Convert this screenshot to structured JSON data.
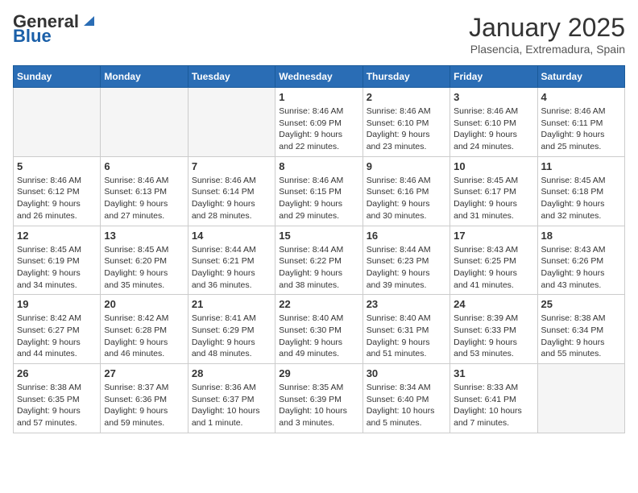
{
  "header": {
    "logo_general": "General",
    "logo_blue": "Blue",
    "month_title": "January 2025",
    "location": "Plasencia, Extremadura, Spain"
  },
  "weekdays": [
    "Sunday",
    "Monday",
    "Tuesday",
    "Wednesday",
    "Thursday",
    "Friday",
    "Saturday"
  ],
  "weeks": [
    [
      {
        "day": "",
        "info": ""
      },
      {
        "day": "",
        "info": ""
      },
      {
        "day": "",
        "info": ""
      },
      {
        "day": "1",
        "info": "Sunrise: 8:46 AM\nSunset: 6:09 PM\nDaylight: 9 hours\nand 22 minutes."
      },
      {
        "day": "2",
        "info": "Sunrise: 8:46 AM\nSunset: 6:10 PM\nDaylight: 9 hours\nand 23 minutes."
      },
      {
        "day": "3",
        "info": "Sunrise: 8:46 AM\nSunset: 6:10 PM\nDaylight: 9 hours\nand 24 minutes."
      },
      {
        "day": "4",
        "info": "Sunrise: 8:46 AM\nSunset: 6:11 PM\nDaylight: 9 hours\nand 25 minutes."
      }
    ],
    [
      {
        "day": "5",
        "info": "Sunrise: 8:46 AM\nSunset: 6:12 PM\nDaylight: 9 hours\nand 26 minutes."
      },
      {
        "day": "6",
        "info": "Sunrise: 8:46 AM\nSunset: 6:13 PM\nDaylight: 9 hours\nand 27 minutes."
      },
      {
        "day": "7",
        "info": "Sunrise: 8:46 AM\nSunset: 6:14 PM\nDaylight: 9 hours\nand 28 minutes."
      },
      {
        "day": "8",
        "info": "Sunrise: 8:46 AM\nSunset: 6:15 PM\nDaylight: 9 hours\nand 29 minutes."
      },
      {
        "day": "9",
        "info": "Sunrise: 8:46 AM\nSunset: 6:16 PM\nDaylight: 9 hours\nand 30 minutes."
      },
      {
        "day": "10",
        "info": "Sunrise: 8:45 AM\nSunset: 6:17 PM\nDaylight: 9 hours\nand 31 minutes."
      },
      {
        "day": "11",
        "info": "Sunrise: 8:45 AM\nSunset: 6:18 PM\nDaylight: 9 hours\nand 32 minutes."
      }
    ],
    [
      {
        "day": "12",
        "info": "Sunrise: 8:45 AM\nSunset: 6:19 PM\nDaylight: 9 hours\nand 34 minutes."
      },
      {
        "day": "13",
        "info": "Sunrise: 8:45 AM\nSunset: 6:20 PM\nDaylight: 9 hours\nand 35 minutes."
      },
      {
        "day": "14",
        "info": "Sunrise: 8:44 AM\nSunset: 6:21 PM\nDaylight: 9 hours\nand 36 minutes."
      },
      {
        "day": "15",
        "info": "Sunrise: 8:44 AM\nSunset: 6:22 PM\nDaylight: 9 hours\nand 38 minutes."
      },
      {
        "day": "16",
        "info": "Sunrise: 8:44 AM\nSunset: 6:23 PM\nDaylight: 9 hours\nand 39 minutes."
      },
      {
        "day": "17",
        "info": "Sunrise: 8:43 AM\nSunset: 6:25 PM\nDaylight: 9 hours\nand 41 minutes."
      },
      {
        "day": "18",
        "info": "Sunrise: 8:43 AM\nSunset: 6:26 PM\nDaylight: 9 hours\nand 43 minutes."
      }
    ],
    [
      {
        "day": "19",
        "info": "Sunrise: 8:42 AM\nSunset: 6:27 PM\nDaylight: 9 hours\nand 44 minutes."
      },
      {
        "day": "20",
        "info": "Sunrise: 8:42 AM\nSunset: 6:28 PM\nDaylight: 9 hours\nand 46 minutes."
      },
      {
        "day": "21",
        "info": "Sunrise: 8:41 AM\nSunset: 6:29 PM\nDaylight: 9 hours\nand 48 minutes."
      },
      {
        "day": "22",
        "info": "Sunrise: 8:40 AM\nSunset: 6:30 PM\nDaylight: 9 hours\nand 49 minutes."
      },
      {
        "day": "23",
        "info": "Sunrise: 8:40 AM\nSunset: 6:31 PM\nDaylight: 9 hours\nand 51 minutes."
      },
      {
        "day": "24",
        "info": "Sunrise: 8:39 AM\nSunset: 6:33 PM\nDaylight: 9 hours\nand 53 minutes."
      },
      {
        "day": "25",
        "info": "Sunrise: 8:38 AM\nSunset: 6:34 PM\nDaylight: 9 hours\nand 55 minutes."
      }
    ],
    [
      {
        "day": "26",
        "info": "Sunrise: 8:38 AM\nSunset: 6:35 PM\nDaylight: 9 hours\nand 57 minutes."
      },
      {
        "day": "27",
        "info": "Sunrise: 8:37 AM\nSunset: 6:36 PM\nDaylight: 9 hours\nand 59 minutes."
      },
      {
        "day": "28",
        "info": "Sunrise: 8:36 AM\nSunset: 6:37 PM\nDaylight: 10 hours\nand 1 minute."
      },
      {
        "day": "29",
        "info": "Sunrise: 8:35 AM\nSunset: 6:39 PM\nDaylight: 10 hours\nand 3 minutes."
      },
      {
        "day": "30",
        "info": "Sunrise: 8:34 AM\nSunset: 6:40 PM\nDaylight: 10 hours\nand 5 minutes."
      },
      {
        "day": "31",
        "info": "Sunrise: 8:33 AM\nSunset: 6:41 PM\nDaylight: 10 hours\nand 7 minutes."
      },
      {
        "day": "",
        "info": ""
      }
    ]
  ]
}
